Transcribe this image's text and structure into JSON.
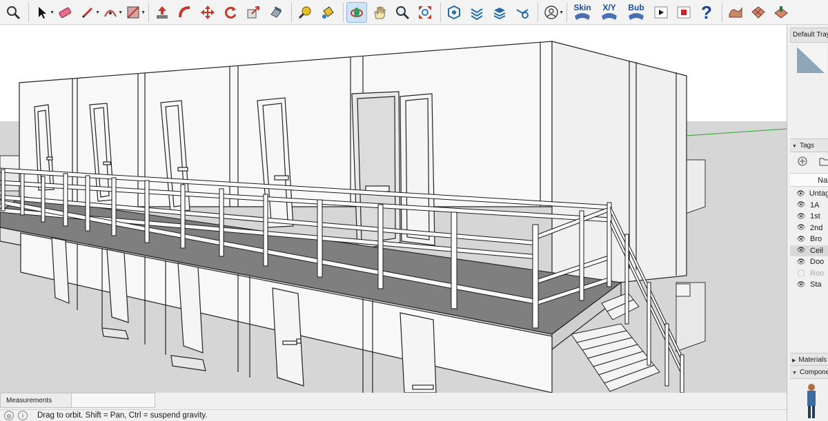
{
  "toolbar": {
    "skin_label": "Skin",
    "xy_label": "X/Y",
    "bub_label": "Bub"
  },
  "tray": {
    "title": "Default Tray",
    "tags_header": "Tags",
    "tags_column_header": "Name",
    "tags": [
      {
        "name": "Untagged",
        "visible": true
      },
      {
        "name": "1A",
        "visible": true
      },
      {
        "name": "1st",
        "visible": true
      },
      {
        "name": "2nd",
        "visible": true
      },
      {
        "name": "Bro",
        "visible": true
      },
      {
        "name": "Ceil",
        "visible": true,
        "selected": true
      },
      {
        "name": "Doo",
        "visible": true
      },
      {
        "name": "Roo",
        "visible": false
      },
      {
        "name": "Sta",
        "visible": true
      }
    ],
    "materials_header": "Materials",
    "components_header": "Components"
  },
  "measurements": {
    "label": "Measurements",
    "value": ""
  },
  "status": {
    "text": "Drag to orbit. Shift = Pan, Ctrl = suspend gravity."
  },
  "colors": {
    "toolbar_bg": "#f3f3f3",
    "ground": "#d6d6d6",
    "floor": "#7f7f7f",
    "wall": "#f7f7f7",
    "active_tool": "#cfe3f6"
  }
}
